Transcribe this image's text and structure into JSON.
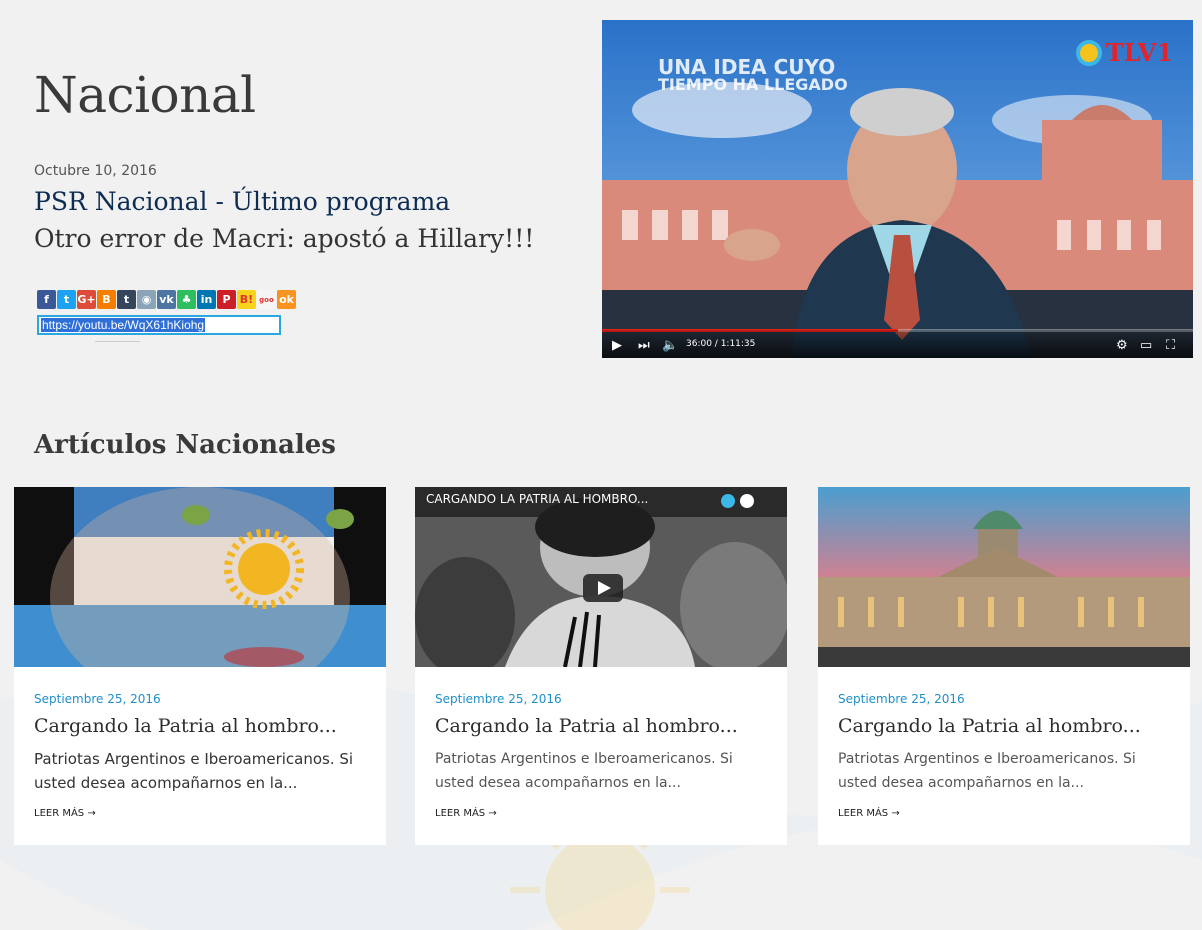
{
  "page": {
    "title": "Nacional"
  },
  "featured": {
    "date": "Octubre 10, 2016",
    "title": "PSR Nacional - Último programa",
    "subtitle": "Otro error de Macri: apostó a Hillary!!!",
    "share_icons": [
      {
        "name": "facebook-icon",
        "glyph": "f",
        "color": "#3b5998"
      },
      {
        "name": "twitter-icon",
        "glyph": "t",
        "color": "#1da1f2"
      },
      {
        "name": "google-plus-icon",
        "glyph": "G+",
        "color": "#dd4b39"
      },
      {
        "name": "blogger-icon",
        "glyph": "B",
        "color": "#f57d00"
      },
      {
        "name": "tumblr-icon",
        "glyph": "t",
        "color": "#35465c"
      },
      {
        "name": "reddit-icon",
        "glyph": "◉",
        "color": "#8aa4b8"
      },
      {
        "name": "vk-icon",
        "glyph": "vk",
        "color": "#4c75a3"
      },
      {
        "name": "evernote-icon",
        "glyph": "♣",
        "color": "#2dbe60"
      },
      {
        "name": "linkedin-icon",
        "glyph": "in",
        "color": "#0077b5"
      },
      {
        "name": "pinterest-icon",
        "glyph": "P",
        "color": "#cb2027"
      },
      {
        "name": "hatena-icon",
        "glyph": "B!",
        "color": "#f8d31b"
      },
      {
        "name": "goo-icon",
        "glyph": "goo",
        "color": "#f5f5f5"
      },
      {
        "name": "odnoklassniki-icon",
        "glyph": "ok",
        "color": "#f7931e"
      }
    ],
    "share_url": "https://youtu.be/WqX61hKiohg"
  },
  "video": {
    "channel_logo": "TLV1",
    "overlay_line1": "UNA IDEA CUYO",
    "overlay_line2": "TIEMPO HA LLEGADO",
    "time": "36:00 / 1:11:35",
    "progress": 0.5
  },
  "section": {
    "title": "Artículos Nacionales"
  },
  "cards": [
    {
      "date": "Septiembre 25, 2016",
      "title": "Cargando la Patria al hombro...",
      "excerpt": "Patriotas Argentinos e Iberoamericanos. Si usted desea acompañarnos en la...",
      "more": "LEER MÁS →"
    },
    {
      "date": "Septiembre 25, 2016",
      "title": "Cargando la Patria al hombro...",
      "excerpt": "Patriotas Argentinos e Iberoamericanos. Si usted desea acompañarnos en la...",
      "more": "LEER MÁS →",
      "image_caption": "CARGANDO LA PATRIA AL HOMBRO..."
    },
    {
      "date": "Septiembre 25, 2016",
      "title": "Cargando la Patria al hombro...",
      "excerpt": "Patriotas Argentinos e Iberoamericanos. Si usted desea acompañarnos en la...",
      "more": "LEER MÁS →"
    }
  ]
}
